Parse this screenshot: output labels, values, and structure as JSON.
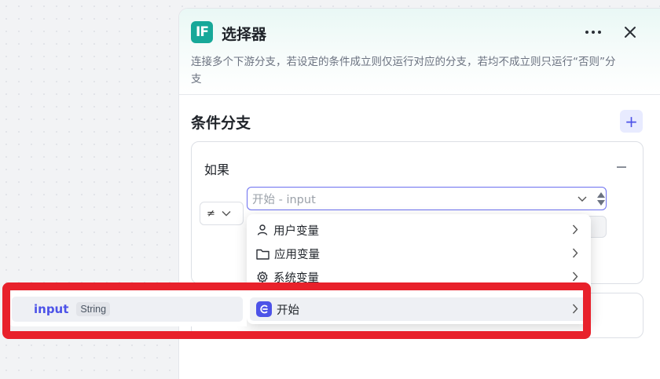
{
  "node": {
    "badge": "IF",
    "title": "选择器",
    "description": "连接多个下游分支，若设定的条件成立则仅运行对应的分支，若均不成立则只运行“否则”分支"
  },
  "branches": {
    "section_title": "条件分支",
    "add_label": "+",
    "if_label": "如果",
    "operator_symbol": "≠",
    "left_value_placeholder": "开始 - input"
  },
  "variable_menu": {
    "items": [
      {
        "label": "用户变量",
        "icon": "user-icon"
      },
      {
        "label": "应用变量",
        "icon": "folder-icon"
      },
      {
        "label": "系统变量",
        "icon": "gear-icon"
      },
      {
        "label": "开始",
        "icon": "start-node-icon"
      }
    ],
    "active_index": 3
  },
  "submenu": {
    "items": [
      {
        "name": "input",
        "type": "String"
      }
    ]
  },
  "colors": {
    "accent": "#4d53e8",
    "node_badge": "#17a899",
    "highlight": "#e8212b"
  }
}
